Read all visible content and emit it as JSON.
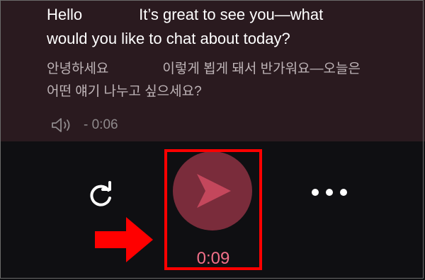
{
  "message": {
    "english": {
      "line1_start": "Hello",
      "line1_end": "It’s great to see you—what",
      "line2": "would you like to chat about today?"
    },
    "korean": {
      "line1_start": "안녕하세요",
      "line1_end": "이렇게 뵙게 돼서 반가워요—오늘은",
      "line2": "어떤 얘기 나누고 싶으세요?"
    },
    "audio": {
      "icon": "speaker-icon",
      "duration": "- 0:06"
    }
  },
  "controls": {
    "refresh_icon": "refresh-icon",
    "send_icon": "send-icon",
    "more_icon": "more-icon",
    "timer": "0:09"
  },
  "annotation": {
    "highlight_color": "#ff0000",
    "arrow_color": "#ff0000"
  },
  "colors": {
    "accent": "#f27089",
    "send_bg": "#7a2c3b",
    "chat_bg": "#2a1a1f",
    "background": "#0f0f12"
  }
}
